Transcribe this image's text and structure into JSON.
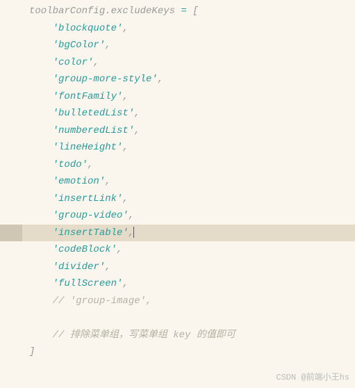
{
  "code": {
    "object": "toolbarConfig",
    "property": "excludeKeys",
    "assign": "=",
    "openBracket": "[",
    "closeBracket": "]",
    "items": [
      "'blockquote'",
      "'bgColor'",
      "'color'",
      "'group-more-style'",
      "'fontFamily'",
      "'bulletedList'",
      "'numberedList'",
      "'lineHeight'",
      "'todo'",
      "'emotion'",
      "'insertLink'",
      "'group-video'",
      "'insertTable'",
      "'codeBlock'",
      "'divider'",
      "'fullScreen'"
    ],
    "commentedItem": "// 'group-image',",
    "commentNote": "// 排除菜单组，写菜单组 key 的值即可",
    "comma": ",",
    "dot": "."
  },
  "highlightIndex": 12,
  "watermark": "CSDN @前端小王hs"
}
